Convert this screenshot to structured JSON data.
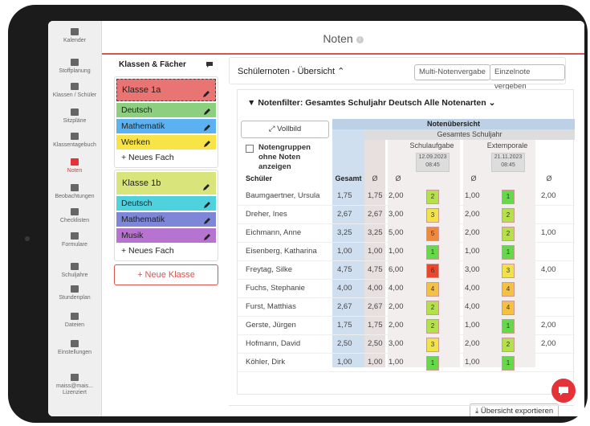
{
  "page": {
    "title": "Noten"
  },
  "sidebar": {
    "items": [
      {
        "label": "Kalender",
        "icon": "calendar-icon"
      },
      {
        "label": "Stoffplanung",
        "icon": "book-icon"
      },
      {
        "label": "Klassen / Schüler",
        "icon": "users-icon"
      },
      {
        "label": "Sitzpläne",
        "icon": "grid-icon"
      },
      {
        "label": "Klassentagebuch",
        "icon": "notebook-icon"
      },
      {
        "label": "Noten",
        "icon": "grades-icon",
        "active": true
      },
      {
        "label": "Beobachtungen",
        "icon": "binoculars-icon"
      },
      {
        "label": "Checklisten",
        "icon": "check-icon"
      },
      {
        "label": "Formulare",
        "icon": "file-icon"
      },
      {
        "label": "Schuljahre",
        "icon": "graduation-cap-icon"
      },
      {
        "label": "Stundenplan",
        "icon": "timetable-icon"
      },
      {
        "label": "Dateien",
        "icon": "files-icon"
      },
      {
        "label": "Einstellungen",
        "icon": "gear-icon"
      },
      {
        "label": "maiss@mais... Lizenziert",
        "icon": "user-icon"
      }
    ]
  },
  "classes_panel": {
    "title": "Klassen & Fächer",
    "classes": [
      {
        "name": "Klasse 1a",
        "color": "#e87573",
        "subjects": [
          {
            "name": "Deutsch",
            "color": "#8bcf7f"
          },
          {
            "name": "Mathematik",
            "color": "#5cb2f0"
          },
          {
            "name": "Werken",
            "color": "#f9e447"
          }
        ]
      },
      {
        "name": "Klasse 1b",
        "color": "#d9e57b",
        "subjects": [
          {
            "name": "Deutsch",
            "color": "#4fd2dd"
          },
          {
            "name": "Mathematik",
            "color": "#7d86d7"
          },
          {
            "name": "Musik",
            "color": "#b673cf"
          }
        ]
      }
    ],
    "add_subject_label": "+ Neues Fach",
    "add_class_label": "+ Neue Klasse"
  },
  "overview": {
    "title": "Schülernoten - Übersicht",
    "multi_button": "Multi-Notenvergabe",
    "single_button": "Einzelnote vergeben",
    "filter_label": "Notenfilter: Gesamtes Schuljahr  Deutsch  Alle Notenarten",
    "fullscreen_label": "Vollbild",
    "checkbox_label": "Notengruppen ohne Noten anzeigen",
    "group_header": "Notenübersicht",
    "subgroup_header": "Gesamtes Schuljahr",
    "col_student": "Schüler",
    "col_total": "Gesamt",
    "col_avg": "Ø",
    "schulaufgabe": {
      "label": "Schulaufgabe",
      "date": "12.09.2023",
      "time": "08:45"
    },
    "extemporale": {
      "label": "Extemporale",
      "date": "21.11.2023",
      "time": "08:45"
    },
    "export_label": "Übersicht exportieren",
    "rows": [
      {
        "name": "Baumgaertner, Ursula",
        "total": "1,75",
        "avg": "1,75",
        "sa_avg": "2,00",
        "sa": "2",
        "sa_color": "#b4e04a",
        "ex_avg": "1,00",
        "ex": "1",
        "ex_color": "#66d94a",
        "x_avg": "2,00"
      },
      {
        "name": "Dreher, Ines",
        "total": "2,67",
        "avg": "2,67",
        "sa_avg": "3,00",
        "sa": "3",
        "sa_color": "#f2e24a",
        "ex_avg": "2,00",
        "ex": "2",
        "ex_color": "#b4e04a",
        "x_avg": ""
      },
      {
        "name": "Eichmann, Anne",
        "total": "3,25",
        "avg": "3,25",
        "sa_avg": "5,00",
        "sa": "5",
        "sa_color": "#f08a3a",
        "ex_avg": "2,00",
        "ex": "2",
        "ex_color": "#b4e04a",
        "x_avg": "1,00"
      },
      {
        "name": "Eisenberg, Katharina",
        "total": "1,00",
        "avg": "1,00",
        "sa_avg": "1,00",
        "sa": "1",
        "sa_color": "#66d94a",
        "ex_avg": "1,00",
        "ex": "1",
        "ex_color": "#66d94a",
        "x_avg": ""
      },
      {
        "name": "Freytag, Silke",
        "total": "4,75",
        "avg": "4,75",
        "sa_avg": "6,00",
        "sa": "6",
        "sa_color": "#e8472b",
        "ex_avg": "3,00",
        "ex": "3",
        "ex_color": "#f2e24a",
        "x_avg": "4,00"
      },
      {
        "name": "Fuchs, Stephanie",
        "total": "4,00",
        "avg": "4,00",
        "sa_avg": "4,00",
        "sa": "4",
        "sa_color": "#f5c145",
        "ex_avg": "4,00",
        "ex": "4",
        "ex_color": "#f5c145",
        "x_avg": ""
      },
      {
        "name": "Furst, Matthias",
        "total": "2,67",
        "avg": "2,67",
        "sa_avg": "2,00",
        "sa": "2",
        "sa_color": "#b4e04a",
        "ex_avg": "4,00",
        "ex": "4",
        "ex_color": "#f5c145",
        "x_avg": ""
      },
      {
        "name": "Gerste, Jürgen",
        "total": "1,75",
        "avg": "1,75",
        "sa_avg": "2,00",
        "sa": "2",
        "sa_color": "#b4e04a",
        "ex_avg": "1,00",
        "ex": "1",
        "ex_color": "#66d94a",
        "x_avg": "2,00"
      },
      {
        "name": "Hofmann, David",
        "total": "2,50",
        "avg": "2,50",
        "sa_avg": "3,00",
        "sa": "3",
        "sa_color": "#f2e24a",
        "ex_avg": "2,00",
        "ex": "2",
        "ex_color": "#b4e04a",
        "x_avg": "2,00"
      },
      {
        "name": "Köhler, Dirk",
        "total": "1,00",
        "avg": "1,00",
        "sa_avg": "1,00",
        "sa": "1",
        "sa_color": "#66d94a",
        "ex_avg": "1,00",
        "ex": "1",
        "ex_color": "#66d94a",
        "x_avg": ""
      }
    ]
  }
}
